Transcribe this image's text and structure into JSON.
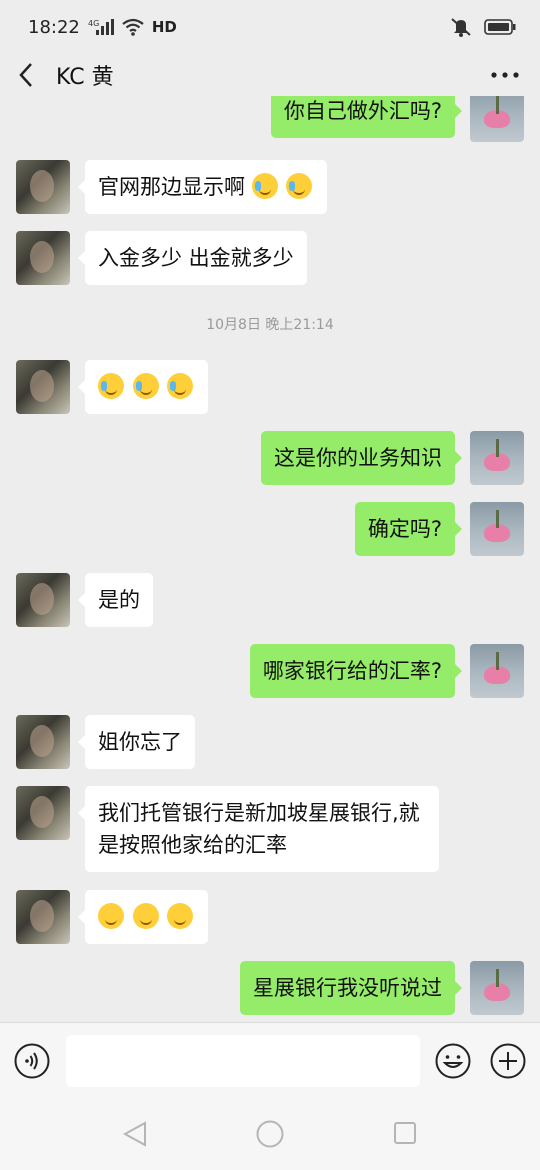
{
  "status_bar": {
    "time": "18:22",
    "network": "4G",
    "hd": "HD"
  },
  "header": {
    "title": "KC 黄"
  },
  "messages": [
    {
      "side": "right",
      "text": "你自己做外汇吗?"
    },
    {
      "side": "left",
      "text": "官网那边显示啊",
      "emojis": [
        "cry",
        "cry"
      ]
    },
    {
      "side": "left",
      "text": "入金多少 出金就多少"
    },
    {
      "side": "timestamp",
      "text": "10月8日 晚上21:14"
    },
    {
      "side": "left",
      "text": "",
      "emojis": [
        "cry",
        "cry",
        "cry"
      ]
    },
    {
      "side": "right",
      "text": "这是你的业务知识"
    },
    {
      "side": "right",
      "text": "确定吗?"
    },
    {
      "side": "left",
      "text": "是的"
    },
    {
      "side": "right",
      "text": "哪家银行给的汇率?"
    },
    {
      "side": "left",
      "text": "姐你忘了"
    },
    {
      "side": "left",
      "text": "我们托管银行是新加坡星展银行,就是按照他家给的汇率"
    },
    {
      "side": "left",
      "text": "",
      "emojis": [
        "smile",
        "smile",
        "smile"
      ]
    },
    {
      "side": "right",
      "text": "星展银行我没听说过"
    }
  ],
  "input": {
    "placeholder": ""
  },
  "colors": {
    "background": "#ededed",
    "bubble_right": "#95ec69",
    "bubble_left": "#ffffff"
  }
}
